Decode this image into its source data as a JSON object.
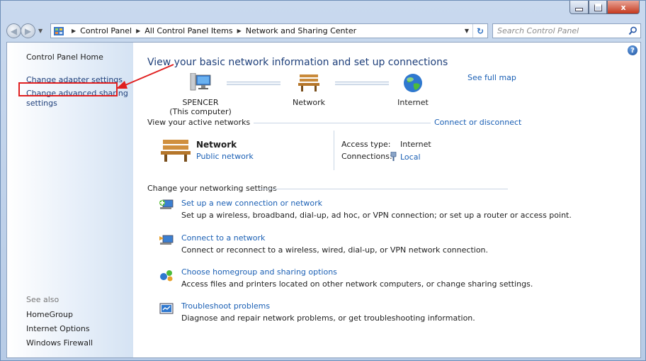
{
  "window": {
    "min_label": "",
    "max_label": "",
    "close_label": "x"
  },
  "address": {
    "crumbs": [
      "Control Panel",
      "All Control Panel Items",
      "Network and Sharing Center"
    ],
    "search_placeholder": "Search Control Panel"
  },
  "left_pane": {
    "home": "Control Panel Home",
    "links": [
      "Change adapter settings",
      "Change advanced sharing",
      "settings"
    ],
    "see_also_label": "See also",
    "see_also": [
      "HomeGroup",
      "Internet Options",
      "Windows Firewall"
    ]
  },
  "main": {
    "heading": "View your basic network information and set up connections",
    "see_full_map": "See full map",
    "map": {
      "computer_name": "SPENCER",
      "computer_sub": "(This computer)",
      "network_label": "Network",
      "internet_label": "Internet"
    },
    "active_header": "View your active networks",
    "connect_link": "Connect or disconnect",
    "active_network": {
      "name": "Network",
      "type": "Public network",
      "access_type_label": "Access type:",
      "access_type_value": "Internet",
      "connections_label": "Connections:",
      "connections_value": "Local"
    },
    "settings_header": "Change your networking settings",
    "tasks": [
      {
        "title": "Set up a new connection or network",
        "desc": "Set up a wireless, broadband, dial-up, ad hoc, or VPN connection; or set up a router or access point."
      },
      {
        "title": "Connect to a network",
        "desc": "Connect or reconnect to a wireless, wired, dial-up, or VPN network connection."
      },
      {
        "title": "Choose homegroup and sharing options",
        "desc": "Access files and printers located on other network computers, or change sharing settings."
      },
      {
        "title": "Troubleshoot problems",
        "desc": "Diagnose and repair network problems, or get troubleshooting information."
      }
    ]
  },
  "colors": {
    "link": "#1a5fb4",
    "heading": "#1e3f7a",
    "annotation": "#e02020"
  }
}
